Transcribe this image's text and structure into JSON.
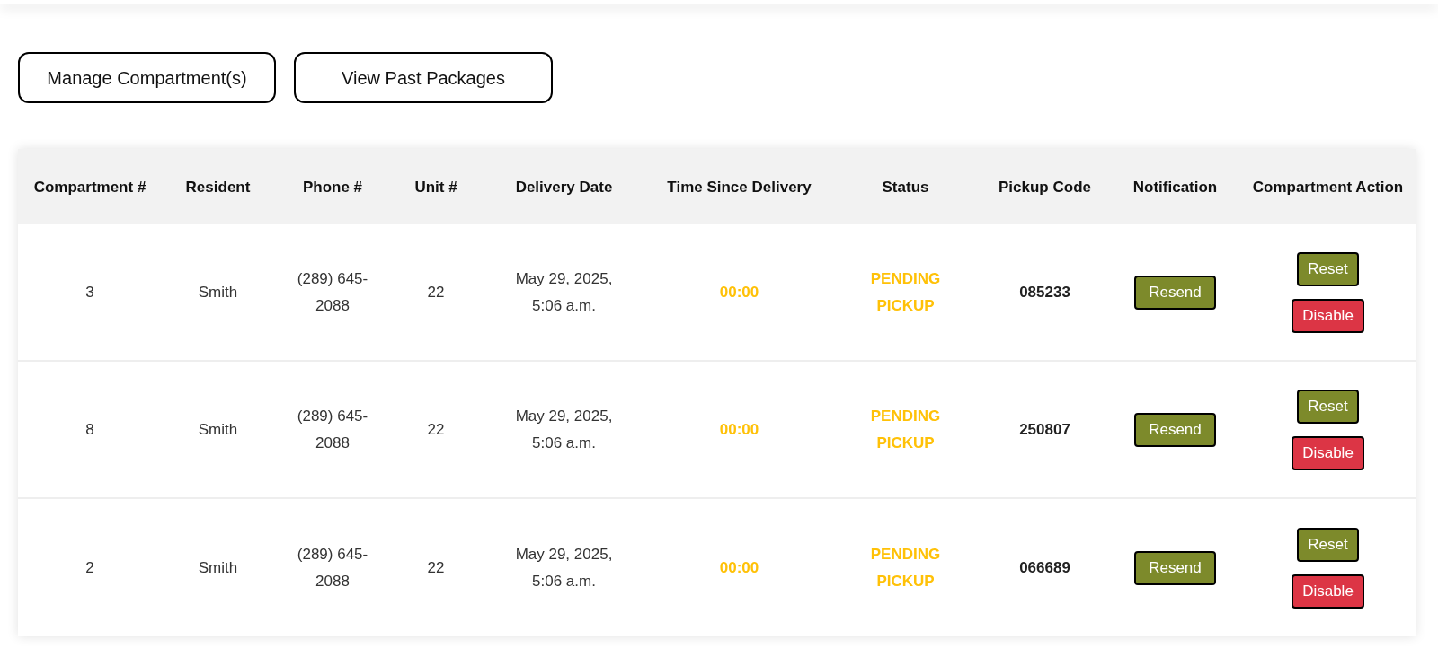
{
  "actions": [
    "Manage Compartment(s)",
    "View Past Packages"
  ],
  "table": {
    "columns": [
      "Compartment #",
      "Resident",
      "Phone #",
      "Unit #",
      "Delivery Date",
      "Time Since Delivery",
      "Status",
      "Pickup Code",
      "Notification",
      "Compartment Action"
    ],
    "rows": [
      {
        "compartment": "3",
        "resident": "Smith",
        "phone": "(289) 645-2088",
        "unit": "22",
        "delivery_date": "May 29, 2025, 5:06 a.m.",
        "time_since": "00:00",
        "status": {
          "label": "PENDING PICKUP",
          "color": "#ffc107"
        },
        "pickup_code": "085233",
        "notification": "Resend",
        "compartment_actions": [
          {
            "label": "Reset",
            "kind": "reset"
          },
          {
            "label": "Disable",
            "kind": "disable"
          }
        ]
      },
      {
        "compartment": "8",
        "resident": "Smith",
        "phone": "(289) 645-2088",
        "unit": "22",
        "delivery_date": "May 29, 2025, 5:06 a.m.",
        "time_since": "00:00",
        "status": {
          "label": "PENDING PICKUP",
          "color": "#ffc107"
        },
        "pickup_code": "250807",
        "notification": "Resend",
        "compartment_actions": [
          {
            "label": "Reset",
            "kind": "reset"
          },
          {
            "label": "Disable",
            "kind": "disable"
          }
        ]
      },
      {
        "compartment": "2",
        "resident": "Smith",
        "phone": "(289) 645-2088",
        "unit": "22",
        "delivery_date": "May 29, 2025, 5:06 a.m.",
        "time_since": "00:00",
        "status": {
          "label": "PENDING PICKUP",
          "color": "#ffc107"
        },
        "pickup_code": "066689",
        "notification": "Resend",
        "compartment_actions": [
          {
            "label": "Reset",
            "kind": "reset"
          },
          {
            "label": "Disable",
            "kind": "disable"
          }
        ]
      }
    ]
  }
}
